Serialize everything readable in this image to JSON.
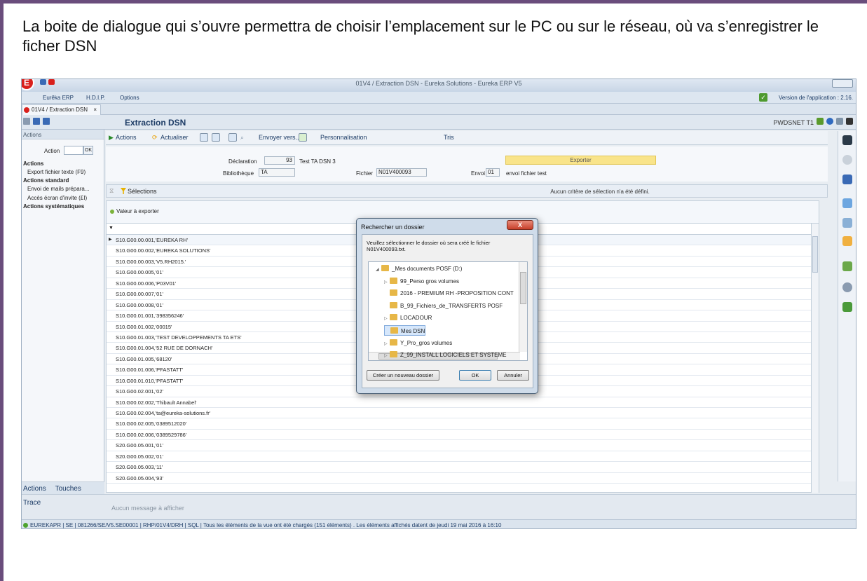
{
  "caption": "La boite de dialogue qui s’ouvre permettra de choisir l’emplacement sur le PC ou sur le réseau, où va s’enregistrer le ficher DSN",
  "window": {
    "title": "01V4 / Extraction DSN - Eureka Solutions - Eureka ERP V5",
    "logo_letter": "E",
    "menu": [
      "Eurêka ERP",
      "H.D.I.P.",
      "Options"
    ],
    "version": "Version de l'application : 2.16."
  },
  "tab": {
    "label": "01V4 / Extraction DSN",
    "close": "×"
  },
  "header": {
    "title": "Extraction DSN",
    "right_label": "PWDSNET T1"
  },
  "left_panel": {
    "header": "Actions",
    "action_label": "Action",
    "ok_label": "OK",
    "items": [
      {
        "label": "Actions",
        "bold": true
      },
      {
        "label": "Export fichier texte (F9)",
        "bold": false
      },
      {
        "label": "Actions standard",
        "bold": true
      },
      {
        "label": "Envoi de mails prépara...",
        "bold": false
      },
      {
        "label": "Accès écran d'invite (£I)",
        "bold": false
      },
      {
        "label": "Actions systématiques",
        "bold": true
      }
    ],
    "bottom_tabs": [
      "Actions",
      "Touches"
    ]
  },
  "toolbar": {
    "actions": "Actions",
    "refresh": "Actualiser",
    "send": "Envoyer vers...",
    "personalize": "Personnalisation",
    "sort": "Tris"
  },
  "form": {
    "declaration_label": "Déclaration",
    "declaration_value": "93",
    "declaration_desc": "Test TA DSN 3",
    "library_label": "Bibliothèque",
    "library_value": "TA",
    "file_label": "Fichier",
    "file_value": "N01V400093",
    "send_label": "Envoi",
    "send_value": "01",
    "send_desc": "envoi fichier test",
    "export_button": "Exporter"
  },
  "selection": {
    "label": "Sélections",
    "message": "Aucun critère de sélection n'a été défini."
  },
  "grid": {
    "column": "Valeur à exporter",
    "rows": [
      "S10.G00.00.001,'EUREKA RH'",
      "S10.G00.00.002,'EUREKA SOLUTIONS'",
      "S10.G00.00.003,'V5.RH2015.'",
      "S10.G00.00.005,'01'",
      "S10.G00.00.006,'P03V01'",
      "S10.G00.00.007,'01'",
      "S10.G00.00.008,'01'",
      "S10.G00.01.001,'398356246'",
      "S10.G00.01.002,'00015'",
      "S10.G00.01.003,'TEST DEVELOPPEMENTS TA ETS'",
      "S10.G00.01.004,'52 RUE DE DORNACH'",
      "S10.G00.01.005,'68120'",
      "S10.G00.01.006,'PFASTATT'",
      "S10.G00.01.010,'PFASTATT'",
      "S10.G00.02.001,'02'",
      "S10.G00.02.002,'Thibault Annabel'",
      "S10.G00.02.004,'ta@eureka-solutions.fr'",
      "S10.G00.02.005,'0389512020'",
      "S10.G00.02.006,'0389529786'",
      "S20.G00.05.001,'01'",
      "S20.G00.05.002,'01'",
      "S20.G00.05.003,'11'",
      "S20.G00.05.004,'93'"
    ]
  },
  "trace": {
    "label": "Trace",
    "message": "Aucun message à afficher"
  },
  "status": "EUREKAPR | SE | 081266/SE/V5.SE00001 | RHP/01V4/DRH | SQL | Tous les éléments de la vue ont été chargés (151 éléments) . Les éléments affichés datent de jeudi 19 mai 2016 à 16:10",
  "dialog": {
    "title": "Rechercher un dossier",
    "close": "X",
    "message": "Veuillez sélectionner le dossier où sera créé le fichier N01V400093.txt.",
    "tree": [
      {
        "label": "_Mes documents POSF (D:)",
        "twisty": "◢",
        "indent": 0
      },
      {
        "label": "99_Perso gros volumes",
        "twisty": "▷",
        "indent": 1
      },
      {
        "label": "2016 - PREMIUM RH -PROPOSITION CONT",
        "twisty": "",
        "indent": 1
      },
      {
        "label": "B_99_Fichiers_de_TRANSFERTS POSF",
        "twisty": "",
        "indent": 1
      },
      {
        "label": "LOCADOUR",
        "twisty": "▷",
        "indent": 1
      },
      {
        "label": "Mes DSN",
        "twisty": "",
        "indent": 1,
        "selected": true
      },
      {
        "label": "Y_Pro_gros volumes",
        "twisty": "▷",
        "indent": 1
      },
      {
        "label": "Z_99_INSTALL LOGICIELS ET SYSTEME",
        "twisty": "▷",
        "indent": 1
      }
    ],
    "new_folder": "Créer un nouveau dossier",
    "ok": "OK",
    "cancel": "Annuler"
  },
  "colors": {
    "frame": "#6a4d7c",
    "export_button": "#f9e48a",
    "close_button": "#c7402a",
    "selected_folder": "#d6e7fb"
  }
}
